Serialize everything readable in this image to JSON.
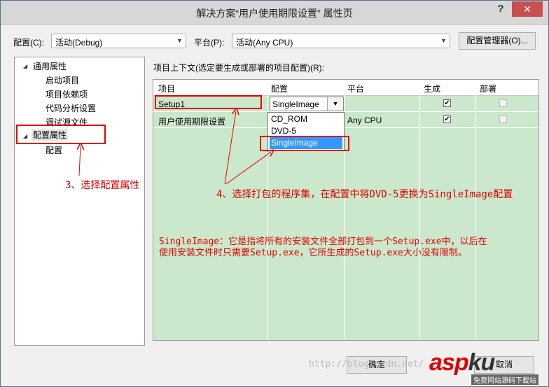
{
  "window": {
    "title": "解决方案“用户使用期限设置” 属性页",
    "help": "?",
    "close": "✕"
  },
  "toolbar": {
    "config_label": "配置(C):",
    "config_value": "活动(Debug)",
    "platform_label": "平台(P):",
    "platform_value": "活动(Any CPU)",
    "config_manager": "配置管理器(O)..."
  },
  "tree": {
    "common": "通用属性",
    "startup": "启动项目",
    "deps": "项目依赖项",
    "code_analysis": "代码分析设置",
    "debug_source": "调试源文件",
    "config_props": "配置属性",
    "config": "配置"
  },
  "grid": {
    "caption": "项目上下文(选定要生成或部署的项目配置)(R):",
    "headers": [
      "项目",
      "配置",
      "平台",
      "生成",
      "部署"
    ],
    "rows": [
      {
        "project": "Setup1",
        "config": "SingleImage",
        "platform": "",
        "build": true,
        "deploy": false
      },
      {
        "project": "用户使用期限设置",
        "config": "",
        "platform": "Any CPU",
        "build": true,
        "deploy": false
      }
    ],
    "dropdown_options": [
      "CD_ROM",
      "DVD-5",
      "SingleImage"
    ]
  },
  "annotations": {
    "step3": "3、选择配置属性",
    "step4": "4、选择打包的程序集，在配置中将DVD-5更换为SingleImage配置",
    "note_line1": "SingleImage：它是指将所有的安装文件全部打包到一个Setup.exe中，以后在",
    "note_line2": "使用安装文件时只需要Setup.exe，它所生成的Setup.exe大小没有限制。"
  },
  "buttons": {
    "ok": "确定",
    "cancel": "取消"
  },
  "watermark": "http://blog.csdn.net/",
  "logo": {
    "a": "asp",
    "b": "ku",
    "sub": "免费网站源码下载站"
  },
  "colors": {
    "grid_bg": "#cce8cc",
    "annotation": "#e00000",
    "selection": "#3399ff"
  }
}
